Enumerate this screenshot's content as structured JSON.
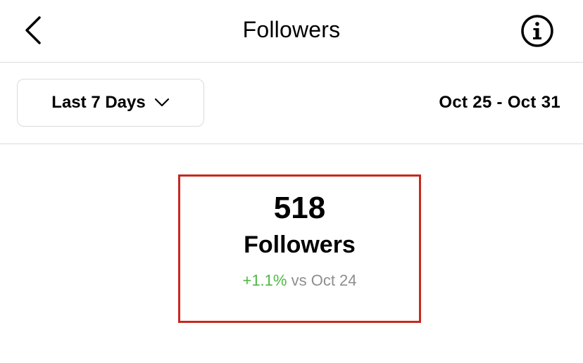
{
  "header": {
    "title": "Followers",
    "back_icon": "chevron-left-icon",
    "info_icon": "info-circle-icon"
  },
  "filter": {
    "range_label": "Last 7 Days",
    "dropdown_icon": "chevron-down-icon",
    "date_range": "Oct 25 - Oct 31"
  },
  "stat": {
    "value": "518",
    "label": "Followers",
    "delta": "+1.1%",
    "comparison": "vs Oct 24"
  },
  "colors": {
    "positive": "#4cb944",
    "highlight_border": "#c8281e",
    "muted_text": "#8e8e8e",
    "divider": "#dbdbdb"
  }
}
